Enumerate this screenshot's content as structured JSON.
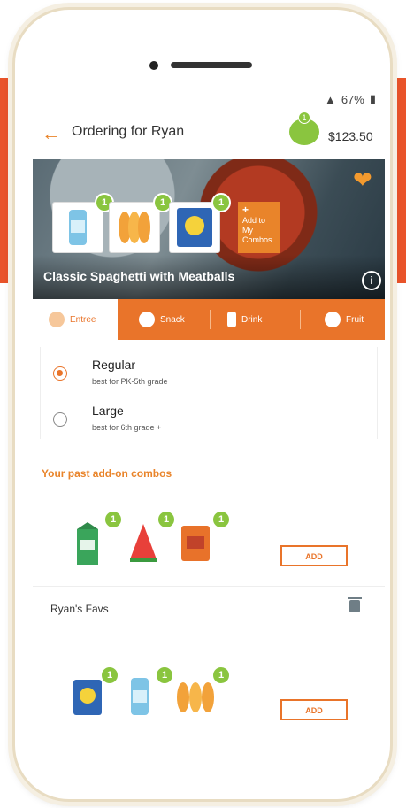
{
  "status": {
    "battery": "67%",
    "signal": "░▓"
  },
  "header": {
    "title": "Ordering for Ryan",
    "balance": "$123.50",
    "piggy_badge": "1"
  },
  "hero": {
    "title": "Classic Spaghetti with Meatballs",
    "items": [
      {
        "name": "juice-drink",
        "count": "1"
      },
      {
        "name": "sliced-peaches",
        "count": "1"
      },
      {
        "name": "chips-bag",
        "count": "1"
      }
    ],
    "add_combo_label": "Add to My Combos"
  },
  "tabs": [
    {
      "label": "Entree",
      "icon": "plate-icon",
      "active": true
    },
    {
      "label": "Snack",
      "icon": "pretzel-icon",
      "active": false
    },
    {
      "label": "Drink",
      "icon": "bottle-icon",
      "active": false
    },
    {
      "label": "Fruit",
      "icon": "apple-icon",
      "active": false
    }
  ],
  "sizes": [
    {
      "label": "Regular",
      "note": "best for PK-5th grade",
      "selected": true
    },
    {
      "label": "Large",
      "note": "best for 6th grade +",
      "selected": false
    }
  ],
  "past_combos": {
    "title": "Your past add-on combos",
    "combo1": {
      "items": [
        {
          "name": "milk-carton",
          "count": "1"
        },
        {
          "name": "watermelon-slice",
          "count": "1"
        },
        {
          "name": "snack-bag",
          "count": "1"
        }
      ],
      "add_label": "ADD"
    },
    "favorites": {
      "label": "Ryan's Favs"
    },
    "combo2": {
      "items": [
        {
          "name": "chips-bag",
          "count": "1"
        },
        {
          "name": "juice-drink",
          "count": "1"
        },
        {
          "name": "sliced-peaches",
          "count": "1"
        }
      ],
      "add_label": "ADD"
    }
  },
  "colors": {
    "accent": "#e9742a",
    "badge": "#8ac53f",
    "balance_piggy": "#8ac53f"
  }
}
